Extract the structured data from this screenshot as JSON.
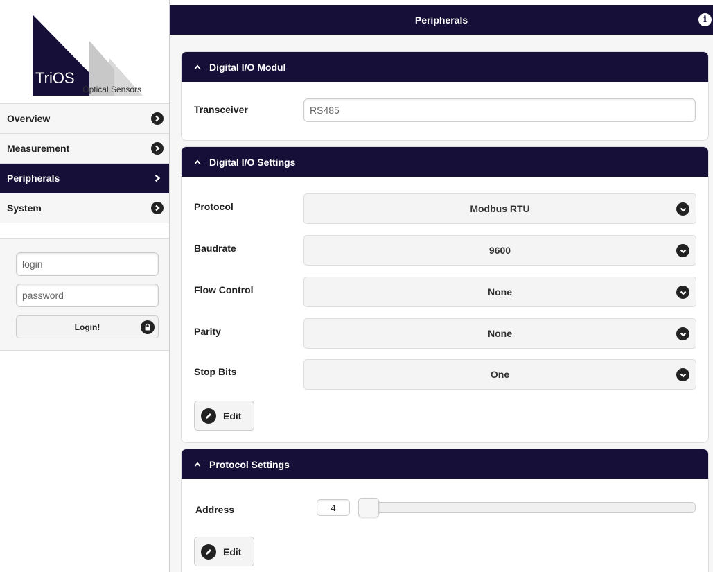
{
  "logo": {
    "name": "TriOS",
    "subtitle": "Optical Sensors"
  },
  "nav": {
    "items": [
      {
        "label": "Overview",
        "active": false
      },
      {
        "label": "Measurement",
        "active": false
      },
      {
        "label": "Peripherals",
        "active": true
      },
      {
        "label": "System",
        "active": false
      }
    ]
  },
  "login": {
    "login_placeholder": "login",
    "password_placeholder": "password",
    "button_label": "Login!"
  },
  "header": {
    "title": "Peripherals"
  },
  "digital_io_modul": {
    "title": "Digital I/O Modul",
    "transceiver_label": "Transceiver",
    "transceiver_value": "RS485"
  },
  "digital_io_settings": {
    "title": "Digital I/O Settings",
    "fields": [
      {
        "label": "Protocol",
        "value": "Modbus RTU"
      },
      {
        "label": "Baudrate",
        "value": "9600"
      },
      {
        "label": "Flow Control",
        "value": "None"
      },
      {
        "label": "Parity",
        "value": "None"
      },
      {
        "label": "Stop Bits",
        "value": "One"
      }
    ],
    "edit_label": "Edit"
  },
  "protocol_settings": {
    "title": "Protocol Settings",
    "address_label": "Address",
    "address_value": "4",
    "address_fraction": 0.0,
    "edit_label": "Edit"
  },
  "colors": {
    "primary": "#161038",
    "background": "#f6f6f6"
  }
}
